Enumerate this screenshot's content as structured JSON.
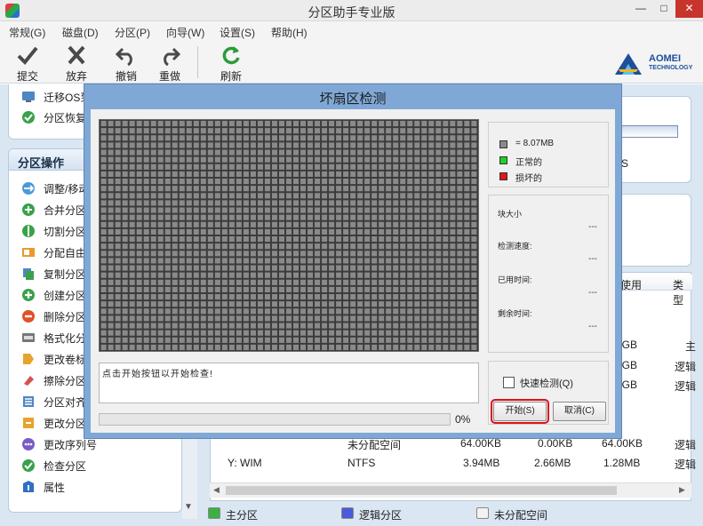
{
  "window": {
    "title": "分区助手专业版",
    "min": "—",
    "max": "□",
    "close": "✕"
  },
  "menu": [
    "常规(G)",
    "磁盘(D)",
    "分区(P)",
    "向导(W)",
    "设置(S)",
    "帮助(H)"
  ],
  "toolbar": {
    "commit": "提交",
    "discard": "放弃",
    "undo": "撤销",
    "redo": "重做",
    "refresh": "刷新"
  },
  "logo": {
    "brand": "AOMEI",
    "sub": "TECHNOLOGY"
  },
  "wizard_items": [
    "迁移OS到",
    "分区恢复"
  ],
  "partition_ops": {
    "header": "分区操作",
    "items": [
      "调整/移动",
      "合并分区",
      "切割分区",
      "分配自由",
      "复制分区",
      "创建分区",
      "删除分区",
      "格式化分",
      "更改卷标",
      "擦除分区",
      "分区对齐",
      "更改分区",
      "更改序列号",
      "检查分区",
      "属性"
    ]
  },
  "right_card": {
    "letter": "S"
  },
  "table": {
    "headers": [
      "使用",
      "类型"
    ],
    "rows": [
      {
        "c4": "5GB",
        "c5": "主"
      },
      {
        "c4": "3GB",
        "c5": "逻辑"
      },
      {
        "c4": "9GB",
        "c5": "逻辑"
      },
      {
        "c1": "未分配空间",
        "c2": "64.00KB",
        "c3": "0.00KB",
        "c4": "64.00KB",
        "c5": "逻辑"
      },
      {
        "c0": "Y: WIM",
        "c1": "NTFS",
        "c2": "3.94MB",
        "c3": "2.66MB",
        "c4": "1.28MB",
        "c5": "逻辑"
      }
    ]
  },
  "legend": [
    {
      "label": "主分区",
      "color": "#3cb043"
    },
    {
      "label": "逻辑分区",
      "color": "#4a5ad8"
    },
    {
      "label": "未分配空间",
      "color": "#f2f2f2"
    }
  ],
  "dialog": {
    "title": "坏扇区检测",
    "legend": [
      {
        "label": "= 8.07MB",
        "color": "#8a8a8a"
      },
      {
        "label": "正常的",
        "color": "#1fd21f"
      },
      {
        "label": "损坏的",
        "color": "#e01818"
      }
    ],
    "stats": [
      {
        "key": "块大小",
        "value": "---"
      },
      {
        "key": "检测速度:",
        "value": "---"
      },
      {
        "key": "已用时间:",
        "value": "---"
      },
      {
        "key": "剩余时间:",
        "value": "---"
      }
    ],
    "message": "点击开始按钮以开始检查!",
    "progress": 0,
    "progress_text": "0%",
    "quick_check": "快速检测(Q)",
    "start": "开始(S)",
    "cancel": "取消(C)"
  }
}
